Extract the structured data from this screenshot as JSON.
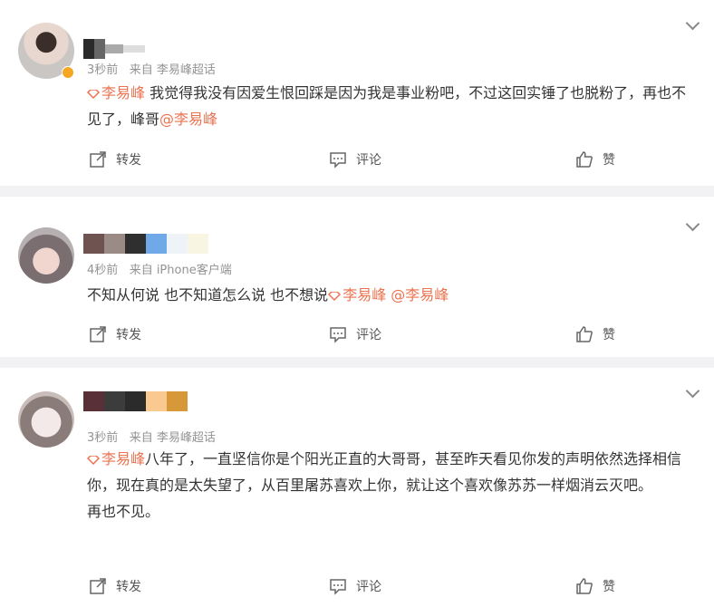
{
  "posts": [
    {
      "meta_time": "3秒前",
      "meta_from": "来自 李易峰超话",
      "tag": "李易峰",
      "text": " 我觉得我没有因爱生恨回踩是因为我是事业粉吧，不过这回实锤了也脱粉了，再也不见了，峰哥",
      "mention": "@李易峰",
      "actions": {
        "repost": "转发",
        "comment": "评论",
        "like": "赞"
      }
    },
    {
      "meta_time": "4秒前",
      "meta_from": "来自 iPhone客户端",
      "text": "不知从何说 也不知道怎么说 也不想说",
      "tag": "李易峰",
      "mention": " @李易峰",
      "actions": {
        "repost": "转发",
        "comment": "评论",
        "like": "赞"
      }
    },
    {
      "meta_time": "3秒前",
      "meta_from": "来自 李易峰超话",
      "tag": "李易峰",
      "text": "八年了，一直坚信你是个阳光正直的大哥哥，甚至昨天看见你发的声明依然选择相信你，现在真的是太失望了，从百里屠苏喜欢上你，就让这个喜欢像苏苏一样烟消云灭吧。",
      "text2": "再也不见。",
      "actions": {
        "repost": "转发",
        "comment": "评论",
        "like": "赞"
      }
    }
  ],
  "colors": {
    "accent": "#eb7350",
    "meta": "#939393",
    "divider": "#f2f2f5"
  },
  "icons": [
    "chevron-down-icon",
    "supertopic-tag-icon",
    "repost-icon",
    "comment-icon",
    "like-icon",
    "verified-badge-icon"
  ]
}
